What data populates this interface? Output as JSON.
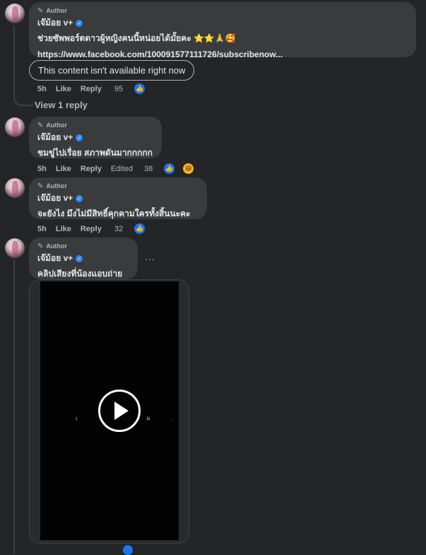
{
  "comments": [
    {
      "author_tag": "Author",
      "name": "เจ๊ม้อย v+",
      "text_lines": [
        "ช่วยซัพพอร์ตดาวผู้หญิงคนนี้หน่อยได้มั้ยคะ ⭐⭐🙏🥰",
        "https://www.facebook.com/100091577111726/subscribenow..."
      ],
      "attachment": "This content isn't available right now",
      "time": "5h",
      "like": "Like",
      "reply": "Reply",
      "edited": "",
      "reaction_count": "95",
      "reactions": [
        "like"
      ]
    },
    {
      "author_tag": "Author",
      "name": "เจ๊ม้อย v+",
      "text_lines": [
        "ชมขู่ไปเรื่อย สภาพดันมากกกกก"
      ],
      "time": "5h",
      "like": "Like",
      "reply": "Reply",
      "edited": "Edited",
      "reaction_count": "38",
      "reactions": [
        "like",
        "haha"
      ]
    },
    {
      "author_tag": "Author",
      "name": "เจ๊ม้อย v+",
      "text_lines": [
        "จะยังไง มึงไม่มีสิทธิ์คุกคามใครทั้งสิ้นนะคะ"
      ],
      "time": "5h",
      "like": "Like",
      "reply": "Reply",
      "edited": "",
      "reaction_count": "32",
      "reactions": [
        "like"
      ]
    },
    {
      "author_tag": "Author",
      "name": "เจ๊ม้อย v+",
      "text_lines": [
        "คลิปเสียงที่น้องแอบถ่าย"
      ],
      "more": "...",
      "video_overlay_text": "เ จ . ม . . ย   v +"
    }
  ],
  "view_reply": "View 1 reply",
  "icons": {
    "pen": "pencil-icon",
    "verified": "verified-badge-icon",
    "like": "like-thumb-icon",
    "haha": "haha-emoji-icon",
    "play": "play-icon"
  },
  "colors": {
    "background": "#242526",
    "bubble": "#3a3b3c",
    "accent": "#1877f2",
    "text": "#e4e6eb",
    "muted": "#b0b3b8"
  }
}
